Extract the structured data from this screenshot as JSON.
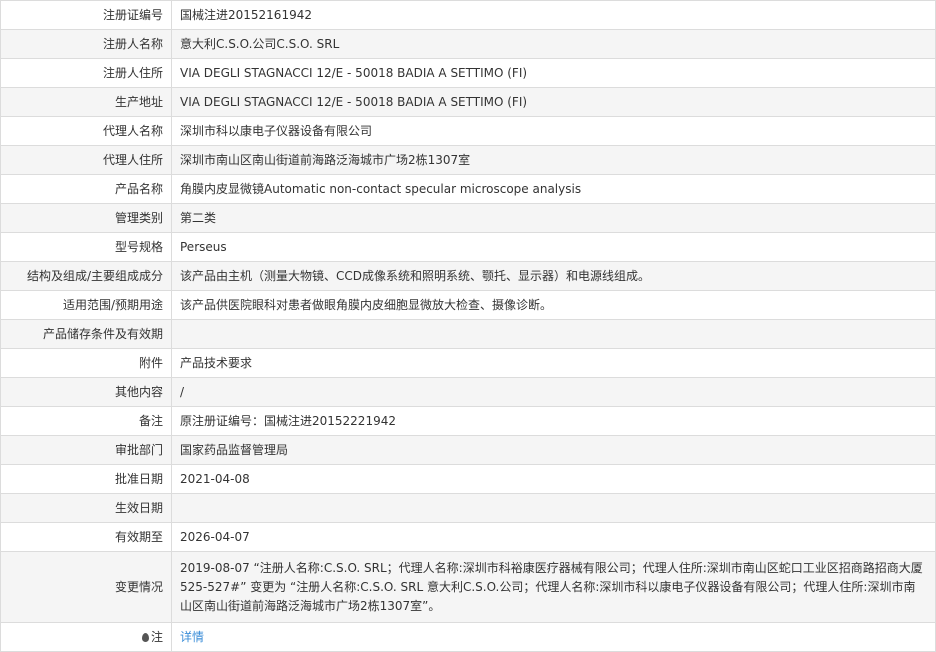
{
  "rows": [
    {
      "label": "注册证编号",
      "value": "国械注进20152161942"
    },
    {
      "label": "注册人名称",
      "value": "意大利C.S.O.公司C.S.O. SRL"
    },
    {
      "label": "注册人住所",
      "value": "VIA DEGLI STAGNACCI 12/E - 50018 BADIA A SETTIMO (FI)"
    },
    {
      "label": "生产地址",
      "value": "VIA DEGLI STAGNACCI 12/E - 50018 BADIA A SETTIMO (FI)"
    },
    {
      "label": "代理人名称",
      "value": "深圳市科以康电子仪器设备有限公司"
    },
    {
      "label": "代理人住所",
      "value": "深圳市南山区南山街道前海路泛海城市广场2栋1307室"
    },
    {
      "label": "产品名称",
      "value": "角膜内皮显微镜Automatic non-contact specular microscope analysis"
    },
    {
      "label": "管理类别",
      "value": "第二类"
    },
    {
      "label": "型号规格",
      "value": "Perseus"
    },
    {
      "label": "结构及组成/主要组成成分",
      "value": "该产品由主机（测量大物镜、CCD成像系统和照明系统、颚托、显示器）和电源线组成。"
    },
    {
      "label": "适用范围/预期用途",
      "value": "该产品供医院眼科对患者做眼角膜内皮细胞显微放大检查、摄像诊断。"
    },
    {
      "label": "产品储存条件及有效期",
      "value": ""
    },
    {
      "label": "附件",
      "value": "产品技术要求"
    },
    {
      "label": "其他内容",
      "value": "/"
    },
    {
      "label": "备注",
      "value": "原注册证编号：国械注进20152221942"
    },
    {
      "label": "审批部门",
      "value": "国家药品监督管理局"
    },
    {
      "label": "批准日期",
      "value": "2021-04-08"
    },
    {
      "label": "生效日期",
      "value": ""
    },
    {
      "label": "有效期至",
      "value": "2026-04-07"
    },
    {
      "label": "变更情况",
      "value": "2019-08-07 “注册人名称:C.S.O. SRL；代理人名称:深圳市科裕康医疗器械有限公司；代理人住所:深圳市南山区蛇口工业区招商路招商大厦525-527#” 变更为 “注册人名称:C.S.O. SRL 意大利C.S.O.公司；代理人名称:深圳市科以康电子仪器设备有限公司；代理人住所:深圳市南山区南山街道前海路泛海城市广场2栋1307室”。"
    }
  ],
  "note": {
    "label": "注",
    "link": "详情"
  }
}
